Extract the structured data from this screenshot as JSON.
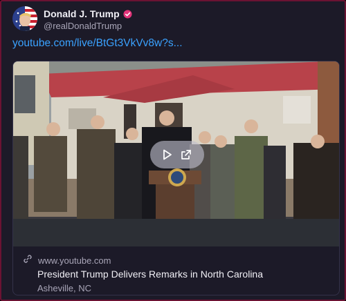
{
  "post": {
    "author": {
      "display_name": "Donald J. Trump",
      "handle": "@realDonaldTrump",
      "verified": true,
      "avatar": "avatar-image",
      "verified_icon": "verified-badge-icon"
    },
    "link_text": "youtube.com/live/BtGt3VkVv8w?s..."
  },
  "card": {
    "thumbnail": "video-thumbnail",
    "controls": {
      "play_icon": "play-icon",
      "open_icon": "open-external-icon"
    },
    "link_icon": "link-icon",
    "domain": "www.youtube.com",
    "title": "President Trump Delivers Remarks in North Carolina",
    "description": "Asheville, NC"
  },
  "colors": {
    "background": "#1c1a28",
    "border": "#6b1232",
    "link": "#3aa2ff",
    "verified_badge": "#e2347a",
    "primary_text": "#f1f0f6",
    "secondary_text": "#a9a6b8"
  }
}
